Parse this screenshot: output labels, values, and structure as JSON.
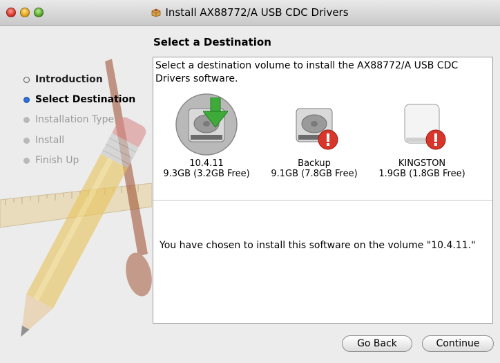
{
  "window": {
    "title": "Install AX88772/A USB CDC Drivers",
    "title_icon": "package-icon"
  },
  "sidebar": {
    "steps": [
      {
        "label": "Introduction",
        "state": "done"
      },
      {
        "label": "Select Destination",
        "state": "current"
      },
      {
        "label": "Installation Type",
        "state": "future"
      },
      {
        "label": "Install",
        "state": "future"
      },
      {
        "label": "Finish Up",
        "state": "future"
      }
    ]
  },
  "main": {
    "heading": "Select a Destination",
    "instruction": "Select a destination volume to install the AX88772/A USB CDC Drivers software.",
    "volumes": [
      {
        "name": "10.4.11",
        "size": "9.3GB (3.2GB Free)",
        "icon": "hard-drive-icon",
        "badge": "green-arrow-icon",
        "selected": true
      },
      {
        "name": "Backup",
        "size": "9.1GB (7.8GB Free)",
        "icon": "hard-drive-icon",
        "badge": "alert-icon",
        "selected": false
      },
      {
        "name": "KINGSTON",
        "size": "1.9GB (1.8GB Free)",
        "icon": "removable-drive-icon",
        "badge": "alert-icon",
        "selected": false
      }
    ],
    "message": "You have chosen to install this software on the volume \"10.4.11.\""
  },
  "buttons": {
    "go_back": "Go Back",
    "continue": "Continue"
  },
  "colors": {
    "accent": "#2f6fd6",
    "alert": "#d8362b",
    "arrow": "#3daa3a"
  }
}
